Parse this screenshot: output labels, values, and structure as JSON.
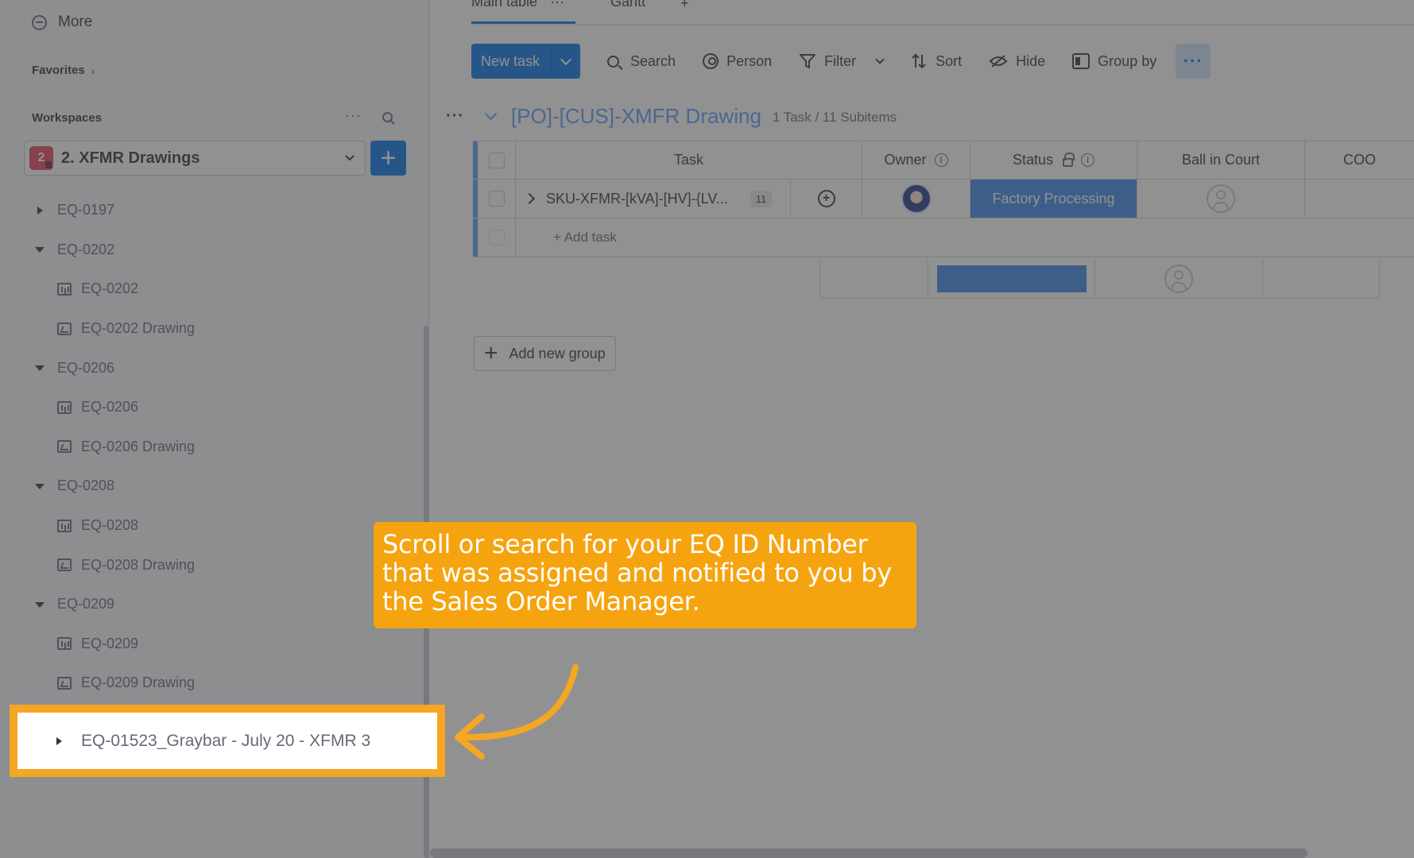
{
  "sidebar": {
    "more_label": "More",
    "favorites_label": "Favorites",
    "workspaces_label": "Workspaces",
    "workspace": {
      "badge": "2",
      "name": "2. XFMR Drawings",
      "badge_color": "#e2445c"
    },
    "tree": [
      {
        "label": "EQ-0197",
        "type": "folder",
        "expanded": false
      },
      {
        "label": "EQ-0202",
        "type": "folder",
        "expanded": true
      },
      {
        "label": "EQ-0202",
        "type": "board"
      },
      {
        "label": "EQ-0202 Drawing",
        "type": "doc"
      },
      {
        "label": "EQ-0206",
        "type": "folder",
        "expanded": true
      },
      {
        "label": "EQ-0206",
        "type": "board"
      },
      {
        "label": "EQ-0206 Drawing",
        "type": "doc"
      },
      {
        "label": "EQ-0208",
        "type": "folder",
        "expanded": true
      },
      {
        "label": "EQ-0208",
        "type": "board"
      },
      {
        "label": "EQ-0208 Drawing",
        "type": "doc"
      },
      {
        "label": "EQ-0209",
        "type": "folder",
        "expanded": true
      },
      {
        "label": "EQ-0209",
        "type": "board"
      },
      {
        "label": "EQ-0209 Drawing",
        "type": "doc"
      }
    ],
    "highlighted_item": "EQ-01523_Graybar - July 20 - XFMR 3"
  },
  "main": {
    "tabs": [
      {
        "label": "Main table",
        "menu": "···",
        "active": true
      },
      {
        "label": "Gantt",
        "active": false
      }
    ],
    "add_tab": "+",
    "toolbar": {
      "new_task": "New task",
      "search": "Search",
      "person": "Person",
      "filter": "Filter",
      "sort": "Sort",
      "hide": "Hide",
      "group_by": "Group by",
      "more": "···"
    },
    "group": {
      "menu": "···",
      "title": "[PO]-[CUS]-XMFR Drawing",
      "count": "1 Task / 11 Subitems",
      "color": "#579bfc"
    },
    "columns": {
      "task": "Task",
      "owner": "Owner",
      "status": "Status",
      "ball": "Ball in Court",
      "coo": "COO"
    },
    "row": {
      "task": "SKU-XFMR-[kVA]-[HV]-{LV...",
      "subitems": "11",
      "status": "Factory Processing",
      "status_color": "#3b86ee"
    },
    "add_task": "+ Add task",
    "add_group": "Add new group"
  },
  "callout": {
    "text_line1": "Scroll or search for your EQ ID Number",
    "text_line2": "that was assigned and notified to you by",
    "text_line3": "the Sales Order Manager.",
    "color": "#f5a40f"
  }
}
